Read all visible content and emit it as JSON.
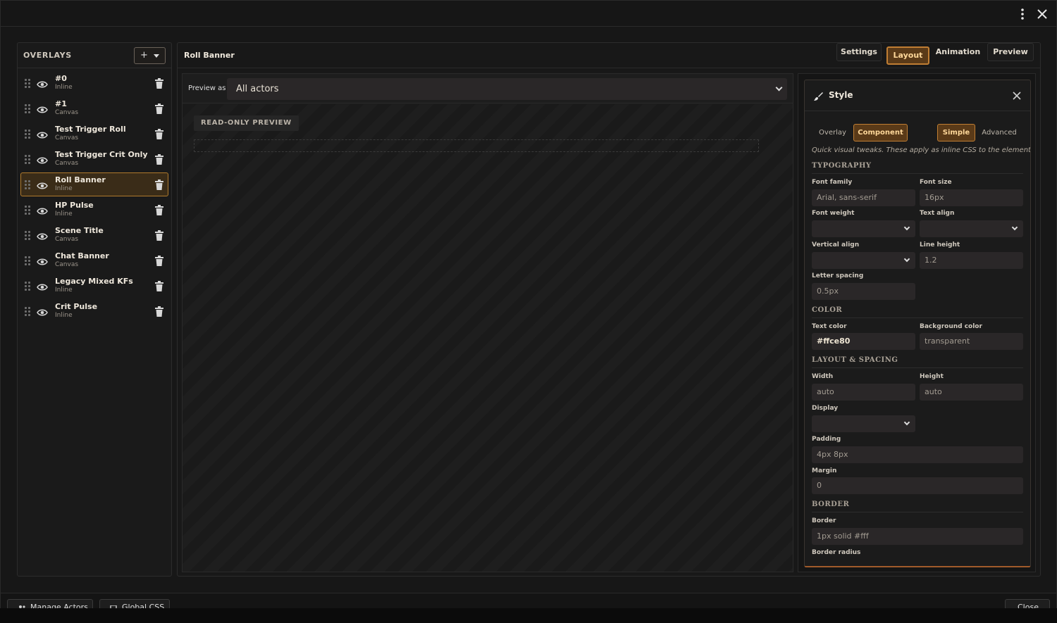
{
  "titlebar": {
    "menu_icon": "vertical-dots-icon",
    "close_icon": "close-icon"
  },
  "sidebar": {
    "title": "OVERLAYS",
    "add_label": "+",
    "items": [
      {
        "name": "#0",
        "type": "Inline"
      },
      {
        "name": "#1",
        "type": "Canvas"
      },
      {
        "name": "Test Trigger Roll",
        "type": "Canvas"
      },
      {
        "name": "Test Trigger Crit Only",
        "type": "Canvas"
      },
      {
        "name": "Roll Banner",
        "type": "Inline",
        "selected": true
      },
      {
        "name": "HP Pulse",
        "type": "Inline"
      },
      {
        "name": "Scene Title",
        "type": "Canvas"
      },
      {
        "name": "Chat Banner",
        "type": "Canvas"
      },
      {
        "name": "Legacy Mixed KFs",
        "type": "Inline"
      },
      {
        "name": "Crit Pulse",
        "type": "Inline"
      }
    ]
  },
  "main": {
    "title": "Roll Banner",
    "tabs": {
      "settings": "Settings",
      "layout": "Layout",
      "animation": "Animation",
      "preview": "Preview"
    },
    "active_tab": "Layout"
  },
  "preview": {
    "label": "Preview as",
    "selected": "All actors",
    "badge": "READ-ONLY PREVIEW"
  },
  "style": {
    "title": "Style",
    "target_tabs": {
      "overlay": "Overlay",
      "component": "Component"
    },
    "mode_tabs": {
      "simple": "Simple",
      "advanced": "Advanced"
    },
    "hint": "Quick visual tweaks. These apply as inline CSS to the element.",
    "sections": {
      "typography": "TYPOGRAPHY",
      "color": "COLOR",
      "layout": "LAYOUT & SPACING",
      "border": "BORDER"
    },
    "labels": {
      "font_family": "Font family",
      "font_size": "Font size",
      "font_weight": "Font weight",
      "text_align": "Text align",
      "vertical_align": "Vertical align",
      "line_height": "Line height",
      "letter_spacing": "Letter spacing",
      "text_color": "Text color",
      "background_color": "Background color",
      "width": "Width",
      "height": "Height",
      "display": "Display",
      "padding": "Padding",
      "margin": "Margin",
      "border": "Border",
      "border_radius": "Border radius"
    },
    "placeholders": {
      "font_family": "Arial, sans-serif",
      "font_size": "16px",
      "line_height": "1.2",
      "letter_spacing": "0.5px",
      "background_color": "transparent",
      "width": "auto",
      "height": "auto",
      "padding": "4px 8px",
      "margin": "0",
      "border": "1px solid #fff"
    },
    "values": {
      "text_color": "#ffce80"
    }
  },
  "footer": {
    "manage_actors": "Manage Actors",
    "global_css": "Global CSS",
    "close": "Close"
  },
  "colors": {
    "accent": "#c07e33",
    "accent_bg": "#5a3a18",
    "selected_row": "#3a2c18"
  }
}
